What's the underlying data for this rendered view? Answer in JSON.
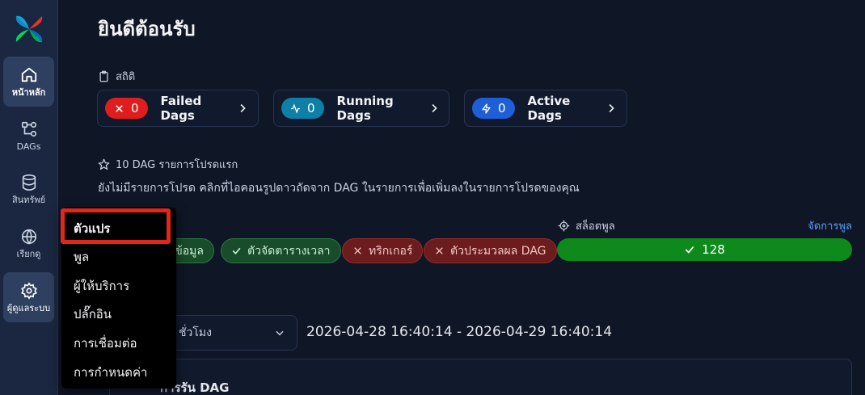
{
  "sidebar": {
    "items": [
      {
        "label": "หน้าหลัก",
        "icon": "home-icon",
        "active": true
      },
      {
        "label": "DAGs",
        "icon": "dag-icon",
        "active": false
      },
      {
        "label": "สินทรัพย์",
        "icon": "database-icon",
        "active": false
      },
      {
        "label": "เรียกดู",
        "icon": "globe-icon",
        "active": false
      },
      {
        "label": "ผู้ดูแลระบบ",
        "icon": "gear-icon",
        "active": false
      }
    ]
  },
  "page": {
    "title": "ยินดีต้อนรับ"
  },
  "stats": {
    "heading": "สถิติ",
    "cards": [
      {
        "count": "0",
        "label": "Failed Dags",
        "color": "#e01d1d",
        "icon": "close-icon"
      },
      {
        "count": "0",
        "label": "Running Dags",
        "color": "#0e7fa6",
        "icon": "activity-icon"
      },
      {
        "count": "0",
        "label": "Active Dags",
        "color": "#1e5fd8",
        "icon": "lightning-icon"
      }
    ]
  },
  "favorites": {
    "heading": "10 DAG รายการโปรดแรก",
    "empty_text": "ยังไม่มีรายการโปรด คลิกที่ไอคอนรูปดาวถัดจาก DAG ในรายการเพื่อเพิ่มลงในรายการโปรดของคุณ"
  },
  "health": {
    "chips": [
      {
        "label": "ข้อมูล",
        "status": "ok"
      },
      {
        "label": "ตัวจัดตารางเวลา",
        "status": "ok"
      },
      {
        "label": "ทริกเกอร์",
        "status": "error"
      },
      {
        "label": "ตัวประมวลผล DAG",
        "status": "error"
      }
    ]
  },
  "pool": {
    "heading": "สล็อตพูล",
    "manage_label": "จัดการพูล",
    "open_slots": "128",
    "color": "#0e8a1c"
  },
  "time_range": {
    "select_value": "ชั่วโมง",
    "range_text": "2026-04-28 16:40:14 - 2026-04-29 16:40:14"
  },
  "dag_runs": {
    "title": "การรัน DAG"
  },
  "admin_menu": {
    "items": [
      {
        "label": "ตัวแปร",
        "highlighted": true
      },
      {
        "label": "พูล"
      },
      {
        "label": "ผู้ให้บริการ"
      },
      {
        "label": "ปลั๊กอิน"
      },
      {
        "label": "การเชื่อมต่อ"
      },
      {
        "label": "การกำหนดค่า"
      }
    ],
    "highlight_color": "#e3261b"
  }
}
